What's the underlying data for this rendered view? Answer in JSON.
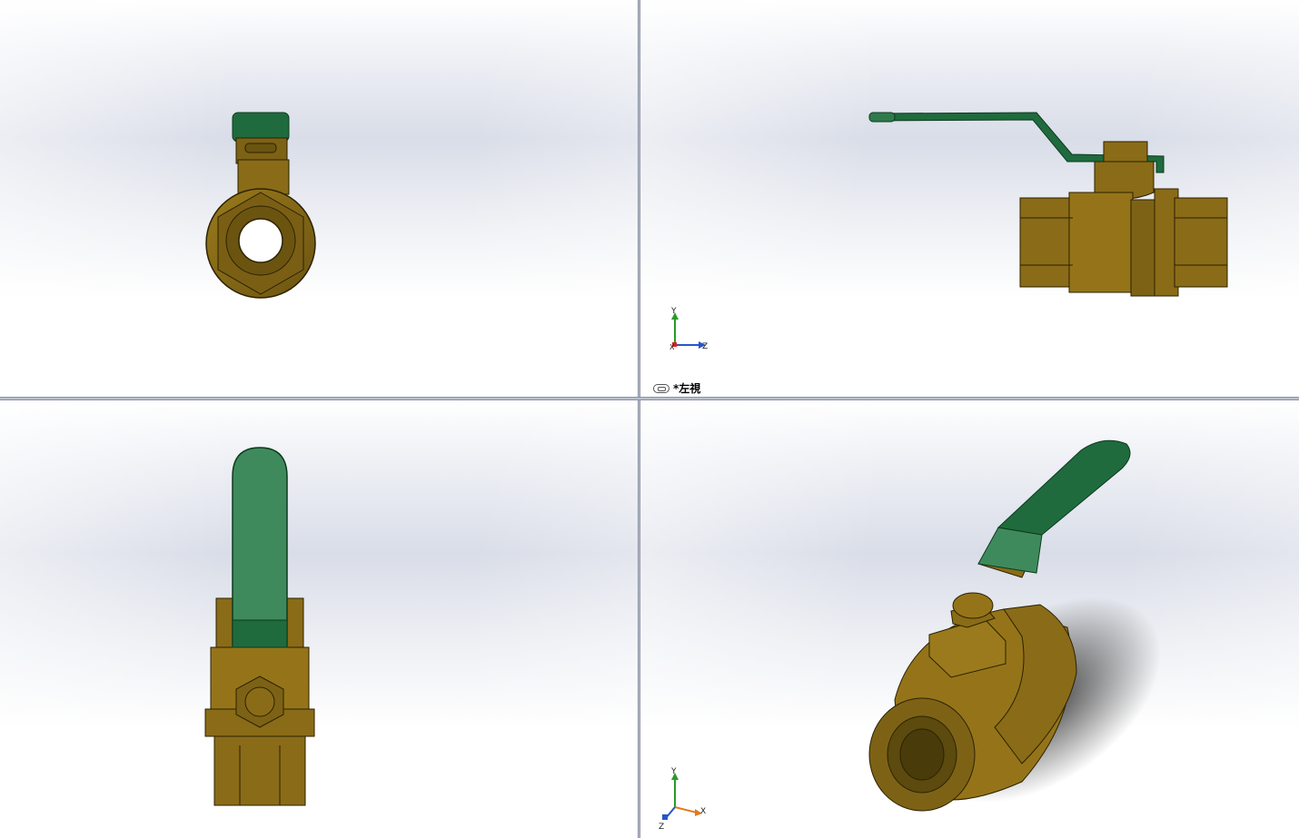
{
  "viewports": {
    "top_right": {
      "view_label": "*左視"
    }
  },
  "triads": {
    "top_right": {
      "y": "Y",
      "x": "X",
      "z": "Z"
    },
    "bottom_right": {
      "y": "Y",
      "x": "X",
      "z": "Z"
    }
  },
  "colors": {
    "brass": "#8a6b17",
    "brass_dark": "#5c4a0e",
    "handle_green": "#1f6b3d",
    "handle_green_light": "#3f8a5c",
    "background": "#dde1ea"
  }
}
